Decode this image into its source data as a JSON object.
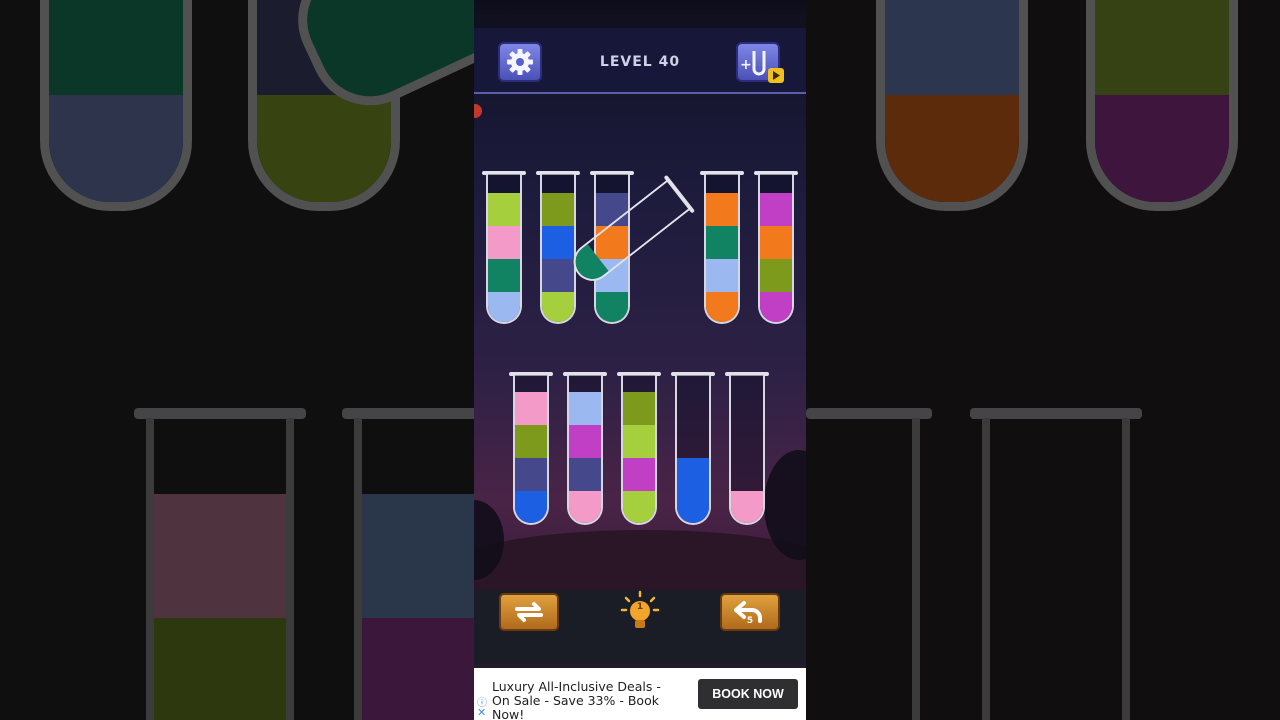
{
  "header": {
    "level_label": "LEVEL 40"
  },
  "icons": {
    "settings": "gear-icon",
    "add_tube": "add-tube-video-icon",
    "restart": "restart-icon",
    "hint": "lightbulb-icon",
    "undo": "undo-icon"
  },
  "colors": {
    "lime": "#a6cf3d",
    "pink": "#f49ac8",
    "green": "#118262",
    "light_blue": "#9bb8f0",
    "olive": "#7e9a1c",
    "blue": "#1c5fe3",
    "navy": "#46488c",
    "orange": "#f27a1c",
    "magenta": "#c03fc4",
    "top_bar": "#17173a",
    "wood_button": "#d18b30"
  },
  "tubes_top": [
    {
      "id": 1,
      "layers": [
        "lime",
        "pink",
        "green",
        "light_blue"
      ]
    },
    {
      "id": 2,
      "layers": [
        "olive",
        "blue",
        "navy",
        "lime"
      ]
    },
    {
      "id": 3,
      "layers": [
        "navy",
        "orange",
        "light_blue",
        "green"
      ]
    },
    {
      "id": 4,
      "layers": [
        "orange",
        "green",
        "light_blue",
        "orange"
      ]
    },
    {
      "id": 5,
      "layers": [
        "magenta",
        "orange",
        "olive",
        "magenta"
      ]
    }
  ],
  "tubes_bottom": [
    {
      "id": 6,
      "layers": [
        "pink",
        "olive",
        "navy",
        "blue"
      ]
    },
    {
      "id": 7,
      "layers": [
        "light_blue",
        "magenta",
        "navy",
        "pink"
      ]
    },
    {
      "id": 8,
      "layers": [
        "olive",
        "lime",
        "magenta",
        "lime"
      ]
    },
    {
      "id": 9,
      "layers": [
        "blue",
        "blue"
      ]
    },
    {
      "id": 10,
      "layers": [
        "pink"
      ]
    }
  ],
  "pouring_tube": {
    "layers": [
      "green"
    ]
  },
  "buttons": {
    "hint_count": "1",
    "undo_count": "5"
  },
  "ad": {
    "text": "Luxury All-Inclusive Deals - On Sale - Save 33% - Book Now!",
    "cta": "BOOK NOW"
  }
}
